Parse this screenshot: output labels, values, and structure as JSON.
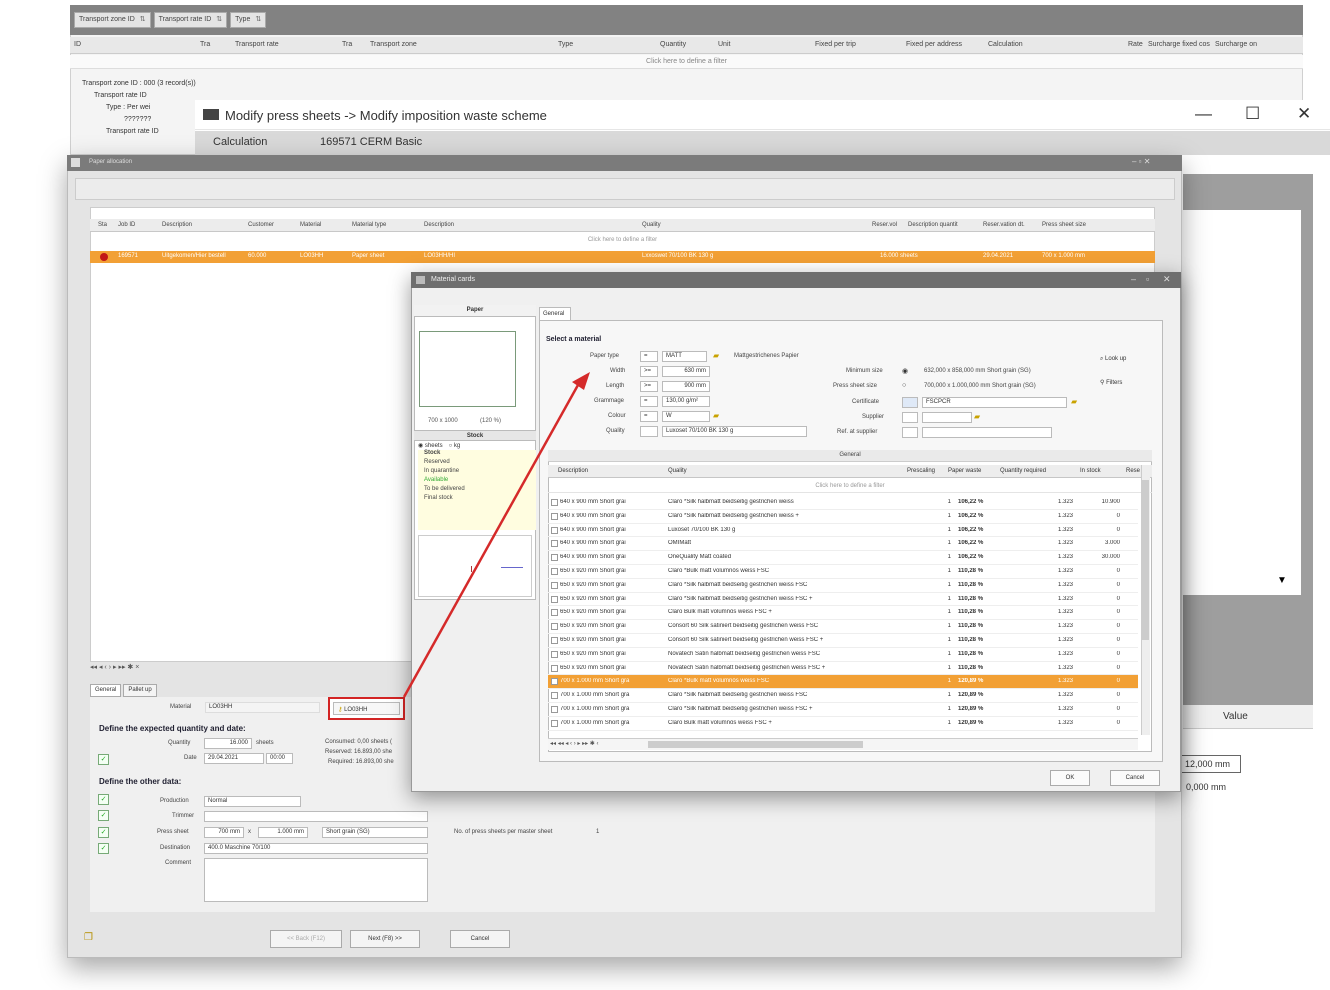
{
  "background_grid": {
    "group_chips": [
      "Transport zone ID",
      "Transport rate ID",
      "Type"
    ],
    "columns": [
      "ID",
      "Tra",
      "Transport rate",
      "Tra",
      "Transport zone",
      "Type",
      "Quantity",
      "Unit",
      "Fixed per trip",
      "Fixed per address",
      "Calculation",
      "Rate",
      "Surcharge fixed cos",
      "Surcharge on"
    ],
    "filter_hint": "Click here to define a filter",
    "tree": [
      "Transport zone ID : 000 (3 record(s))",
      "Transport rate ID",
      "Type : Per wei",
      "???????",
      "Transport rate ID"
    ]
  },
  "modify_window": {
    "title": "Modify press sheets -> Modify imposition waste scheme",
    "calc_label": "Calculation",
    "calc_value": "169571 CERM Basic",
    "minimize": "—",
    "maximize": "☐",
    "close": "✕",
    "value_header": "Value",
    "value_1": "12,000 mm",
    "value_2": "0,000 mm",
    "dropdown_arrow": "▼"
  },
  "paper_allocation": {
    "title": "Paper allocation",
    "columns": [
      "Sta",
      "Job ID",
      "Description",
      "Customer",
      "Material",
      "Material type",
      "Description",
      "Quality",
      "Reser.vol",
      "Description quantit",
      "Reser.vation dt.",
      "Press sheet size"
    ],
    "filter_hint": "Click here to define a filter",
    "selected_row": [
      "169571",
      "Uitgekomen/Hier bestell",
      "60.000",
      "LO03HH",
      "Paper sheet",
      "LO03HH/HI",
      "Lxxoswet 70/100 BK 130 g",
      "16.000 sheets",
      "29.04.2021",
      "700 x 1.000 mm"
    ],
    "nav": "◂◂ ◂ ‹ › ▸ ▸▸ ✱ ×",
    "tabs": [
      "General",
      "Pallet up"
    ],
    "material_label": "Material",
    "material_value": "LO03HH",
    "lookup_button": "LO03HH",
    "expected_heading": "Define the expected quantity and date:",
    "quantity_label": "Quantity",
    "quantity_value": "16.000",
    "quantity_unit": "sheets",
    "date_label": "Date",
    "date_value": "29.04.2021",
    "time_value": "00:00",
    "consumed": "Consumed: 0,00 sheets (",
    "reserved": "Reserved: 16.893,00 she",
    "required": "Required: 16.893,00 she",
    "other_heading": "Define the other data:",
    "production_label": "Production",
    "production_value": "Normal",
    "trimmer_label": "Trimmer",
    "press_sheet_label": "Press sheet",
    "press_w": "700 mm",
    "press_x": "x",
    "press_h": "1.000 mm",
    "grain": "Short grain (SG)",
    "press_sheets_per_master": "No. of press sheets per master sheet",
    "press_sheets_per_master_value": "1",
    "destination_label": "Destination",
    "destination_value": "400.0 Maschine 70/100",
    "comment_label": "Comment",
    "back_button": "<< Back (F12)",
    "next_button": "Next (F8) >>",
    "cancel_button": "Cancel"
  },
  "material_cards": {
    "title": "Material cards",
    "paper_header": "Paper",
    "paper_size": "700 x 1000",
    "paper_size_pct": "(120 %)",
    "stock_header": "Stock",
    "stock_units": [
      "sheets",
      "kg"
    ],
    "stock_items": [
      "Stock",
      "Reserved",
      "In quarantine",
      "Available",
      "To be delivered",
      "Final stock"
    ],
    "tab_general": "General",
    "select_heading": "Select a material",
    "paper_type_label": "Paper type",
    "paper_type_op": "=",
    "paper_type_value": "MATT",
    "paper_type_desc": "Mattgestrichenes Papier",
    "width_label": "Width",
    "width_op": ">=",
    "width_value": "630 mm",
    "length_label": "Length",
    "length_op": ">=",
    "length_value": "900 mm",
    "grammage_label": "Grammage",
    "grammage_op": "=",
    "grammage_value": "130,00 g/m²",
    "colour_label": "Colour",
    "colour_op": "=",
    "colour_value": "W",
    "quality_label": "Quality",
    "quality_value": "Luxoset 70/100 BK 130 g",
    "minimum_size_label": "Minimum size",
    "minimum_size_value": "632,000 x 858,000 mm Short grain (SG)",
    "press_sheet_size_label": "Press sheet size",
    "press_sheet_size_value": "700,000 x 1.000,000 mm Short grain (SG)",
    "certificate_label": "Certificate",
    "certificate_value": "FSCPCR",
    "supplier_label": "Supplier",
    "ref_supplier_label": "Ref. at supplier",
    "look_up": "Look up",
    "filters": "Filters",
    "group_header": "General",
    "columns": [
      "Description",
      "Quality",
      "Prescaling",
      "Paper waste",
      "Quantity required",
      "In stock",
      "Rese"
    ],
    "filter_hint": "Click here to define a filter",
    "rows": [
      {
        "desc": "640 x 900 mm Short grai",
        "quality": "Claro *Silk halbmatt beidseitig gestrichen weiss",
        "pre": "1",
        "waste": "106,22 %",
        "req": "1.323",
        "stock": "10.900"
      },
      {
        "desc": "640 x 900 mm Short grai",
        "quality": "Claro *Silk halbmatt beidseitig gestrichen weiss +",
        "pre": "1",
        "waste": "106,22 %",
        "req": "1.323",
        "stock": "0"
      },
      {
        "desc": "640 x 900 mm Short grai",
        "quality": "Luxoset 70/100 BK 130 g",
        "pre": "1",
        "waste": "106,22 %",
        "req": "1.323",
        "stock": "0"
      },
      {
        "desc": "640 x 900 mm Short grai",
        "quality": "OMIMatt",
        "pre": "1",
        "waste": "106,22 %",
        "req": "1.323",
        "stock": "3.000"
      },
      {
        "desc": "640 x 900 mm Short grai",
        "quality": "OneQuality Matt coated",
        "pre": "1",
        "waste": "106,22 %",
        "req": "1.323",
        "stock": "30.000"
      },
      {
        "desc": "650 x 920 mm Short grai",
        "quality": "Claro *Bulk matt volumnös weiss FSC",
        "pre": "1",
        "waste": "110,28 %",
        "req": "1.323",
        "stock": "0"
      },
      {
        "desc": "650 x 920 mm Short grai",
        "quality": "Claro *Silk halbmatt beidseitig gestrichen weiss FSC",
        "pre": "1",
        "waste": "110,28 %",
        "req": "1.323",
        "stock": "0"
      },
      {
        "desc": "650 x 920 mm Short grai",
        "quality": "Claro *Silk halbmatt beidseitig gestrichen weiss FSC +",
        "pre": "1",
        "waste": "110,28 %",
        "req": "1.323",
        "stock": "0"
      },
      {
        "desc": "650 x 920 mm Short grai",
        "quality": "Claro Bulk matt volumnös weiss FSC +",
        "pre": "1",
        "waste": "110,28 %",
        "req": "1.323",
        "stock": "0"
      },
      {
        "desc": "650 x 920 mm Short grai",
        "quality": "Consort 60 Silk satiniert beidseitig gestrichen weiss FSC",
        "pre": "1",
        "waste": "110,28 %",
        "req": "1.323",
        "stock": "0"
      },
      {
        "desc": "650 x 920 mm Short grai",
        "quality": "Consort 60 Silk satiniert beidseitig gestrichen weiss FSC +",
        "pre": "1",
        "waste": "110,28 %",
        "req": "1.323",
        "stock": "0"
      },
      {
        "desc": "650 x 920 mm Short grai",
        "quality": "Novatech Satin halbmatt beidseitig gestrichen weiss FSC",
        "pre": "1",
        "waste": "110,28 %",
        "req": "1.323",
        "stock": "0"
      },
      {
        "desc": "650 x 920 mm Short grai",
        "quality": "Novatech Satin halbmatt beidseitig gestrichen weiss FSC +",
        "pre": "1",
        "waste": "110,28 %",
        "req": "1.323",
        "stock": "0"
      },
      {
        "desc": "700 x 1.000 mm Short gra",
        "quality": "Claro *Bulk matt volumnös weiss FSC",
        "pre": "1",
        "waste": "120,89 %",
        "req": "1.323",
        "stock": "0",
        "selected": true
      },
      {
        "desc": "700 x 1.000 mm Short gra",
        "quality": "Claro *Silk halbmatt beidseitig gestrichen weiss FSC",
        "pre": "1",
        "waste": "120,89 %",
        "req": "1.323",
        "stock": "0"
      },
      {
        "desc": "700 x 1.000 mm Short gra",
        "quality": "Claro *Silk halbmatt beidseitig gestrichen weiss FSC +",
        "pre": "1",
        "waste": "120,89 %",
        "req": "1.323",
        "stock": "0"
      },
      {
        "desc": "700 x 1.000 mm Short gra",
        "quality": "Claro Bulk matt volumnös weiss FSC +",
        "pre": "1",
        "waste": "120,89 %",
        "req": "1.323",
        "stock": "0"
      }
    ],
    "nav": "◂◂ ◂◂ ◂ ‹ › ▸ ▸▸ ✱ ‹",
    "ok_button": "OK",
    "cancel_button": "Cancel"
  },
  "colors": {
    "accent_orange": "#f2a035",
    "highlight_red": "#d32424"
  }
}
